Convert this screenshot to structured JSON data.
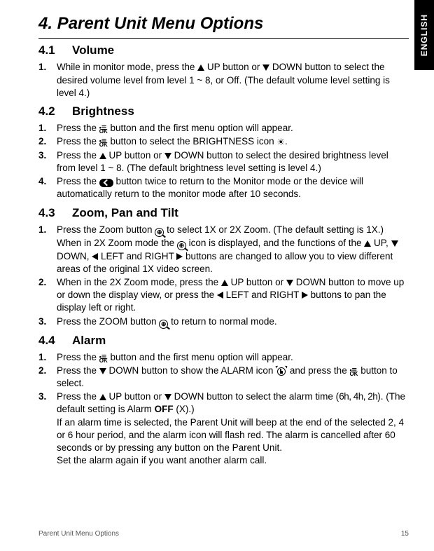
{
  "language_tab": "ENGLISH",
  "title": "4. Parent Unit Menu Options",
  "s41": {
    "num": "4.1",
    "name": "Volume",
    "i1a": "While in monitor mode, press the ",
    "i1b": " UP button or ",
    "i1c": " DOWN button to select the desired volume level from level 1 ~ 8, or Off. (The default volume level setting is level 4.)"
  },
  "s42": {
    "num": "4.2",
    "name": "Brightness",
    "i1a": "Press the ",
    "i1b": " button and the first menu option will appear.",
    "i2a": "Press the ",
    "i2b": " button to select the BRIGHTNESS icon ",
    "i2c": ".",
    "i3a": "Press the ",
    "i3b": " UP button or ",
    "i3c": " DOWN button to select the desired brightness level from level 1 ~ 8. (The default brightness level setting is level 4.)",
    "i4a": "Press the ",
    "i4b": " button twice to return to the Monitor mode or the device will automatically return to the monitor mode after 10 seconds."
  },
  "s43": {
    "num": "4.3",
    "name": "Zoom, Pan and Tilt",
    "i1a": "Press the Zoom button ",
    "i1b": " to select 1X or 2X Zoom. (The default setting is 1X.) When in 2X Zoom mode the ",
    "i1c": " icon is displayed, and the functions of the ",
    "i1d": " UP, ",
    "i1e": " DOWN,  ",
    "i1f": " LEFT and RIGHT  ",
    "i1g": " buttons are changed to allow you to view different areas of the original 1X video screen.",
    "i2a": "When in the 2X Zoom mode, press the ",
    "i2b": " UP button or ",
    "i2c": " DOWN button to move up or down the display view, or press the ",
    "i2d": " LEFT and RIGHT  ",
    "i2e": " buttons to pan the display left or right.",
    "i3a": "Press the ZOOM button ",
    "i3b": " to return to normal mode."
  },
  "s44": {
    "num": "4.4",
    "name": "Alarm",
    "i1a": "Press the ",
    "i1b": " button and the first menu option will appear.",
    "i2a": "Press the ",
    "i2b": " DOWN button to show the ALARM icon ",
    "i2c": " and press the ",
    "i2d": " button to select.",
    "i3a": "Press the ",
    "i3b": " UP button or ",
    "i3c": " DOWN button to select the alarm time (",
    "i3_opts": "6h, 4h, 2h",
    "i3d": "). (The default setting is Alarm ",
    "i3_off": "OFF",
    "i3e": " (X).)",
    "i3f": "If an alarm time is selected, the Parent Unit will beep at the end of the selected 2, 4 or 6 hour period, and the alarm icon will flash red. The alarm is cancelled after 60 seconds or by pressing any button on the Parent Unit.",
    "i3g": "Set the alarm again if you want another alarm call."
  },
  "footer": {
    "section": "Parent Unit Menu Options",
    "page": "15"
  },
  "step_numbers": {
    "n1": "1.",
    "n2": "2.",
    "n3": "3.",
    "n4": "4."
  }
}
